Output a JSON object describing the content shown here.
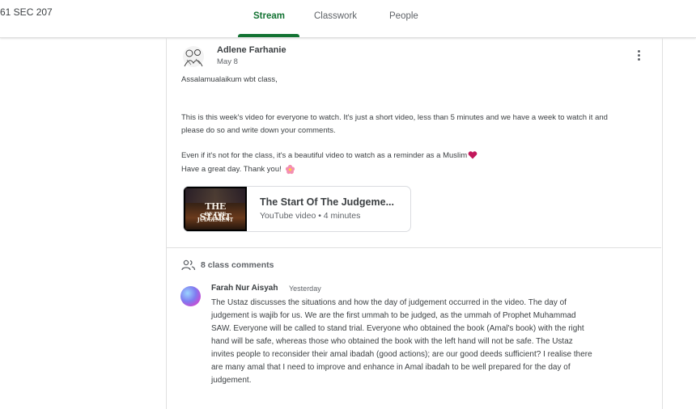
{
  "header": {
    "class_name": "61 SEC 207",
    "tabs": [
      {
        "label": "Stream",
        "active": true
      },
      {
        "label": "Classwork",
        "active": false
      },
      {
        "label": "People",
        "active": false
      }
    ],
    "accent_color": "#137333"
  },
  "post": {
    "author": "Adlene Farhanie",
    "date": "May 8",
    "menu_icon": "more-vert-icon",
    "body": [
      "Assalamualaikum wbt class,",
      "This is this week's video for everyone to watch. It's just a short video, less than 5 minutes and we have a week to watch it and",
      "please do so and write down your comments.",
      "Even if it's not for the class, it's a beautiful video to watch as a reminder as a Muslim",
      "Have a great day. Thank you!"
    ],
    "emoji": [
      "heart-icon",
      "flower-icon"
    ],
    "attachment": {
      "thumbnail_text_1": "THE START",
      "thumbnail_text_2": "OF THE JUDGEMENT",
      "title": "The Start Of The Judgeme...",
      "subtitle": "YouTube video • 4 minutes"
    }
  },
  "comments": {
    "count_label": "8 class comments",
    "items": [
      {
        "name": "Farah Nur Aisyah",
        "time": "Yesterday",
        "lines": [
          "The Ustaz discusses the situations and how the day of judgement occurred in the video. The day of",
          "judgement is wajib for us. We are the first ummah to be judged, as the ummah of Prophet Muhammad",
          "SAW. Everyone will be called to stand trial. Everyone who obtained the book (Amal's book) with the right",
          "hand will be safe, whereas those who obtained the book with the left hand will not be safe. The Ustaz",
          "invites people to reconsider their amal ibadah (good actions); are our good deeds sufficient? I realise there",
          "are many amal that I need to improve and enhance in Amal ibadah to be well prepared for the day of",
          "judgement."
        ]
      }
    ]
  }
}
